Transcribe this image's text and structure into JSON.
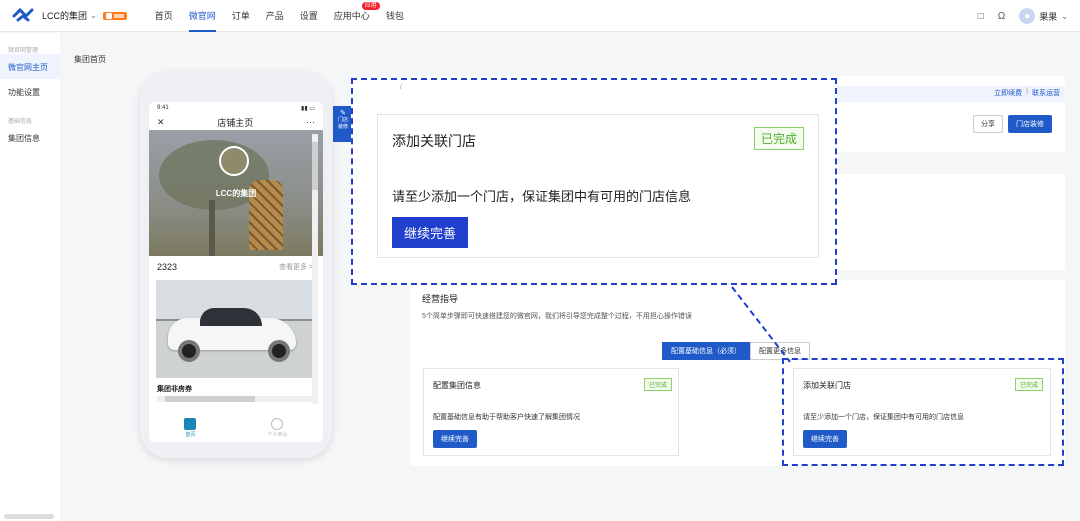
{
  "header": {
    "brand": "LCC的集团",
    "nav": [
      {
        "label": "首页",
        "active": false
      },
      {
        "label": "微官网",
        "active": true
      },
      {
        "label": "订单",
        "active": false
      },
      {
        "label": "产品",
        "active": false
      },
      {
        "label": "设置",
        "active": false
      },
      {
        "label": "应用中心",
        "active": false,
        "badge": "应用"
      },
      {
        "label": "钱包",
        "active": false
      }
    ],
    "user": "果果"
  },
  "sidebar": {
    "group1": "微官网管理",
    "items": [
      "微官网主页",
      "功能设置"
    ],
    "group2": "基础信息",
    "items2": [
      "集团信息"
    ]
  },
  "breadcrumb": "集团首页",
  "phone": {
    "time": "9:41",
    "title": "店铺主页",
    "more": "···",
    "store_name": "LCC的集团",
    "count": "2323",
    "view_more": "查看更多 >",
    "card_title": "集团非房券",
    "tabs": [
      "首页",
      "个人中心"
    ]
  },
  "decor_tab": {
    "line1": "门店",
    "line2": "装修"
  },
  "top_panel": {
    "link1": "立即续费",
    "sep": "|",
    "link2": "联系运营",
    "btn_share": "分享",
    "btn_decor": "门店装修"
  },
  "guide": {
    "title": "经营指导",
    "desc": "5个简单步骤即可快速搭建您的微官网，我们将引导您完成整个过程，不用担心操作错误",
    "seg_on": "配置基础信息（必须）",
    "seg_off": "配置更多信息"
  },
  "card1": {
    "title": "配置集团信息",
    "status": "已完成",
    "desc": "配置基础信息有助于帮助客户快速了解集团情况",
    "button": "继续完善"
  },
  "card2": {
    "title": "添加关联门店",
    "status": "已完成",
    "desc": "请至少添加一个门店，保证集团中有可用的门店信息",
    "button": "继续完善"
  },
  "zoom": {
    "slash": "/",
    "title": "添加关联门店",
    "status": "已完成",
    "desc": "请至少添加一个门店，保证集团中有可用的门店信息",
    "button": "继续完善"
  },
  "colors": {
    "primary": "#1f5ac8",
    "done": "#52b02d",
    "dashed": "#1f3fcc"
  }
}
